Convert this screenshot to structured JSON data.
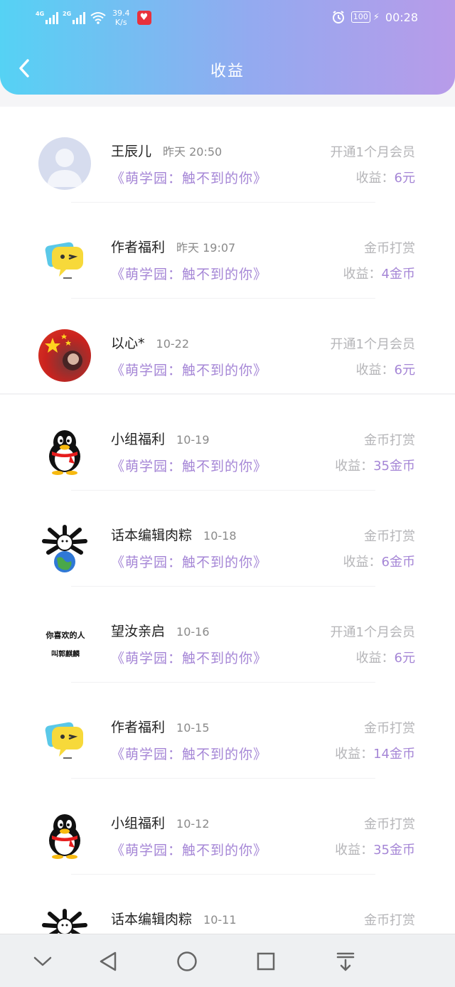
{
  "status_bar": {
    "net1": "4G",
    "net2": "2G",
    "speed_value": "39.4",
    "speed_unit": "K/s",
    "battery": "100",
    "time": "00:28"
  },
  "header": {
    "title": "收益"
  },
  "items": [
    {
      "name": "王辰儿",
      "date": "昨天 20:50",
      "book": "《萌学园：触不到的你》",
      "type": "开通1个月会员",
      "earn_label": "收益：",
      "earn_amount": "6元"
    },
    {
      "name": "作者福利",
      "date": "昨天 19:07",
      "book": "《萌学园：触不到的你》",
      "type": "金币打赏",
      "earn_label": "收益：",
      "earn_amount": "4金币"
    },
    {
      "name": "以心*",
      "date": "10-22",
      "book": "《萌学园：触不到的你》",
      "type": "开通1个月会员",
      "earn_label": "收益：",
      "earn_amount": "6元"
    },
    {
      "name": "小组福利",
      "date": "10-19",
      "book": "《萌学园：触不到的你》",
      "type": "金币打赏",
      "earn_label": "收益：",
      "earn_amount": "35金币"
    },
    {
      "name": "话本编辑肉粽",
      "date": "10-18",
      "book": "《萌学园：触不到的你》",
      "type": "金币打赏",
      "earn_label": "收益：",
      "earn_amount": "6金币"
    },
    {
      "name": "望汝亲启",
      "date": "10-16",
      "book": "《萌学园：触不到的你》",
      "type": "开通1个月会员",
      "earn_label": "收益：",
      "earn_amount": "6元",
      "avatar_text_1": "你喜欢的人",
      "avatar_text_2": "叫郭麒麟"
    },
    {
      "name": "作者福利",
      "date": "10-15",
      "book": "《萌学园：触不到的你》",
      "type": "金币打赏",
      "earn_label": "收益：",
      "earn_amount": "14金币"
    },
    {
      "name": "小组福利",
      "date": "10-12",
      "book": "《萌学园：触不到的你》",
      "type": "金币打赏",
      "earn_label": "收益：",
      "earn_amount": "35金币"
    },
    {
      "name": "话本编辑肉粽",
      "date": "10-11",
      "type": "金币打赏"
    }
  ],
  "colors": {
    "accent": "#a586d6",
    "header_start": "#55d2f4",
    "header_end": "#b89be9"
  }
}
